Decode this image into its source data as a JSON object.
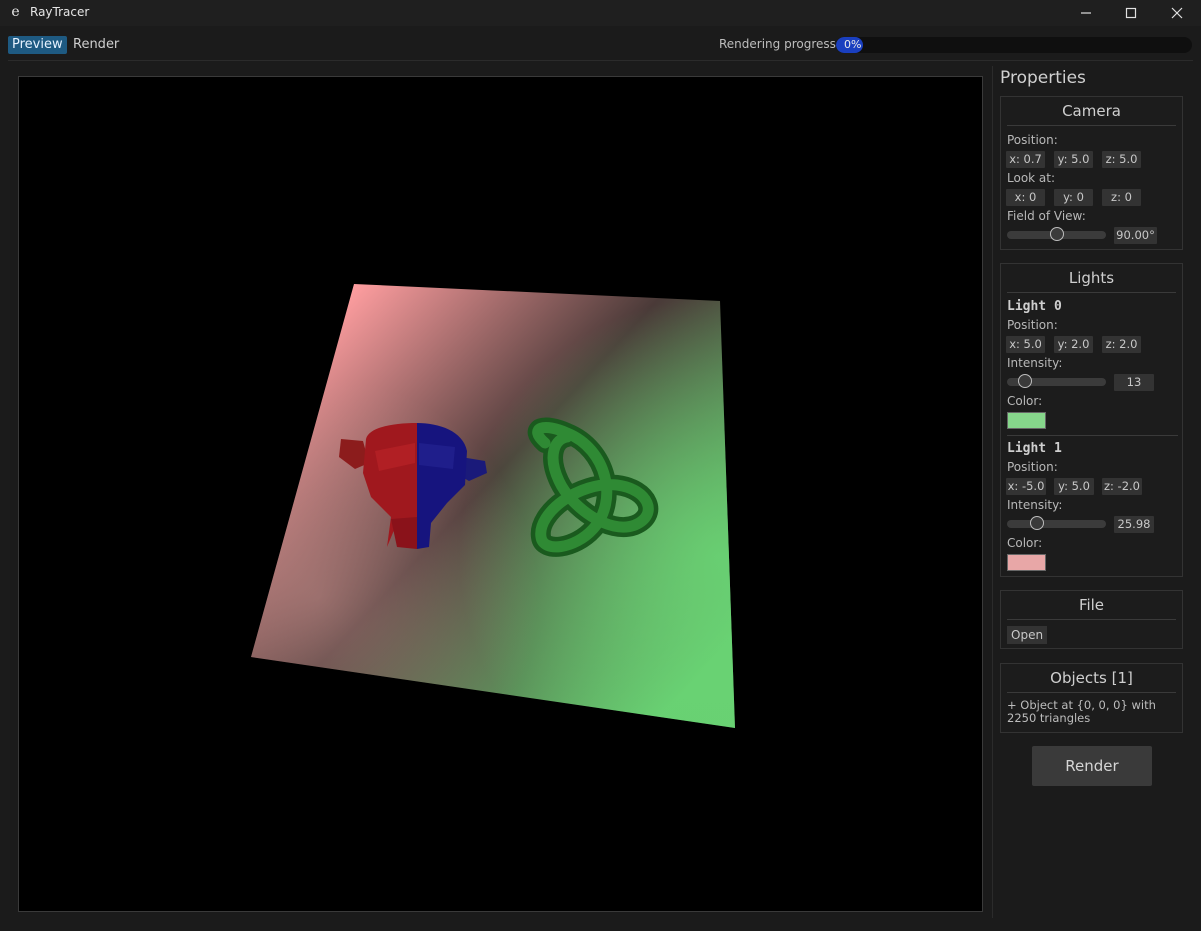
{
  "window": {
    "title": "RayTracer",
    "icon": "e"
  },
  "menu": {
    "tabs": [
      {
        "label": "Preview",
        "active": true
      },
      {
        "label": "Render",
        "active": false
      }
    ]
  },
  "progress": {
    "label": "Rendering progress",
    "value_text": "0%",
    "value": 0
  },
  "properties": {
    "title": "Properties",
    "camera": {
      "title": "Camera",
      "position_label": "Position:",
      "position": {
        "x": "x: 0.7",
        "y": "y: 5.0",
        "z": "z: 5.0"
      },
      "lookat_label": "Look at:",
      "lookat": {
        "x": "x: 0",
        "y": "y: 0",
        "z": "z: 0"
      },
      "fov_label": "Field of View:",
      "fov_value": "90.00°",
      "fov_fraction": 0.5
    },
    "lights": {
      "title": "Lights",
      "items": [
        {
          "name": "Light 0",
          "position_label": "Position:",
          "x": "x: 5.0",
          "y": "y: 2.0",
          "z": "z: 2.0",
          "intensity_label": "Intensity:",
          "intensity": "13",
          "intensity_fraction": 0.18,
          "color_label": "Color:",
          "color": "#86d68b"
        },
        {
          "name": "Light 1",
          "position_label": "Position:",
          "x": "x: -5.0",
          "y": "y: 5.0",
          "z": "z: -2.0",
          "intensity_label": "Intensity:",
          "intensity": "25.98",
          "intensity_fraction": 0.3,
          "color_label": "Color:",
          "color": "#e8a7a7"
        }
      ]
    },
    "file": {
      "title": "File",
      "open_label": "Open"
    },
    "objects": {
      "title": "Objects [1]",
      "items": [
        "+ Object at {0, 0, 0} with 2250 triangles"
      ]
    },
    "render_label": "Render"
  },
  "colors": {
    "accent": "#1e5a82",
    "progress": "#1a3fbf",
    "background": "#1b1b1b"
  }
}
